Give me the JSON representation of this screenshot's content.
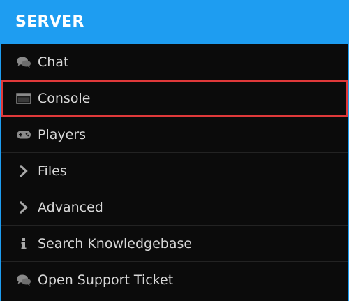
{
  "header": {
    "title": "SERVER",
    "background_color": "#1e9df1"
  },
  "highlight_color": "#e0393a",
  "menu": {
    "items": [
      {
        "label": "Chat",
        "icon": "chat-icon"
      },
      {
        "label": "Console",
        "icon": "console-icon",
        "highlighted": true
      },
      {
        "label": "Players",
        "icon": "gamepad-icon"
      },
      {
        "label": "Files",
        "icon": "chevron-right-icon"
      },
      {
        "label": "Advanced",
        "icon": "chevron-right-icon"
      },
      {
        "label": "Search Knowledgebase",
        "icon": "info-icon"
      },
      {
        "label": "Open Support Ticket",
        "icon": "chat-icon"
      }
    ]
  }
}
